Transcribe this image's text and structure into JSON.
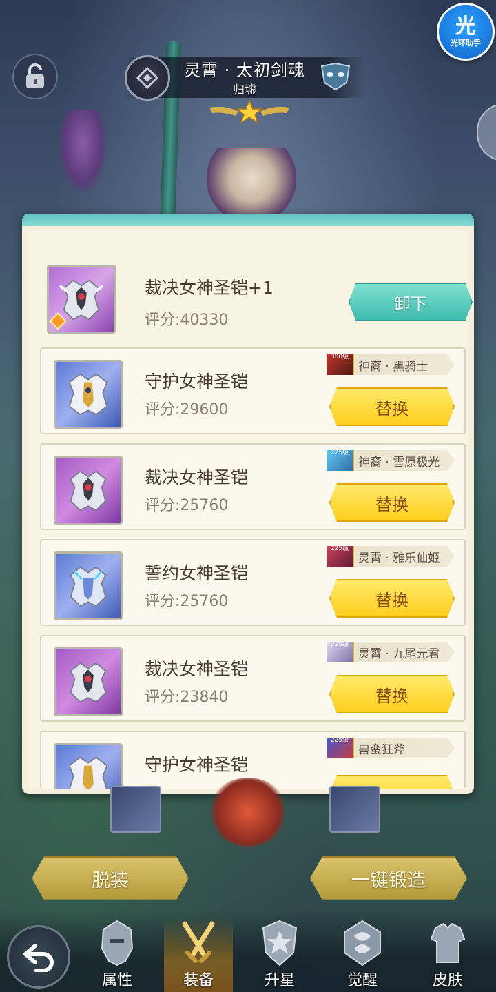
{
  "hero": {
    "name": "灵霄 · 太初剑魂",
    "subtitle": "归墟"
  },
  "helper": {
    "icon_char": "光",
    "label": "光环助手"
  },
  "current_equipment": {
    "name": "裁决女神圣铠+1",
    "score": "评分:40330",
    "action": "卸下",
    "icon": "judgment-armor-icon"
  },
  "equipment_list": [
    {
      "name": "守护女神圣铠",
      "score": "评分:29600",
      "owner": "神裔 · 黑骑士",
      "owner_level": "300级",
      "action": "替换",
      "icon": "guardian-armor-icon"
    },
    {
      "name": "裁决女神圣铠",
      "score": "评分:25760",
      "owner": "神裔 · 雪原极光",
      "owner_level": "225级",
      "action": "替换",
      "icon": "judgment-armor-icon"
    },
    {
      "name": "誓约女神圣铠",
      "score": "评分:25760",
      "owner": "灵霄 · 雅乐仙姬",
      "owner_level": "225级",
      "action": "替换",
      "icon": "oath-armor-icon"
    },
    {
      "name": "裁决女神圣铠",
      "score": "评分:23840",
      "owner": "灵霄 · 九尾元君",
      "owner_level": "225级",
      "action": "替换",
      "icon": "judgment-armor-icon"
    },
    {
      "name": "守护女神圣铠",
      "score": "",
      "owner": "兽蛮狂斧",
      "owner_level": "225级",
      "action": "",
      "icon": "guardian-armor-icon"
    }
  ],
  "bottom_actions": {
    "unequip_all": "脱装",
    "one_key_forge": "一键锻造"
  },
  "nav": {
    "tabs": [
      {
        "label": "属性",
        "icon": "helmet-icon"
      },
      {
        "label": "装备",
        "icon": "crossed-swords-icon",
        "active": true
      },
      {
        "label": "升星",
        "icon": "star-shield-icon"
      },
      {
        "label": "觉醒",
        "icon": "awaken-emblem-icon"
      },
      {
        "label": "皮肤",
        "icon": "skin-armor-icon"
      }
    ]
  },
  "colors": {
    "replace_button": "#ffd83a",
    "remove_button": "#4cc7b8",
    "panel_bg": "#f3efdc"
  }
}
